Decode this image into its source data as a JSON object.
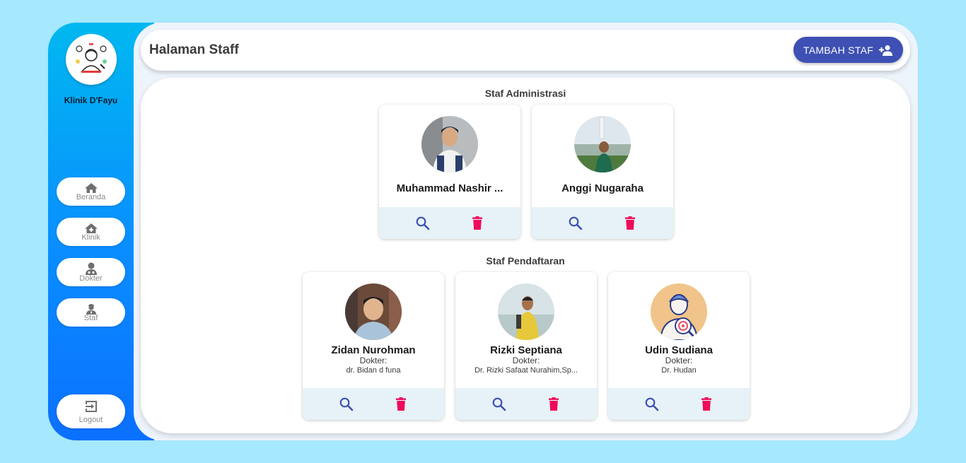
{
  "sidebar": {
    "clinic_name": "Klinik D'Fayu",
    "nav": [
      {
        "label": "Beranda",
        "icon": "home-icon"
      },
      {
        "label": "Klinik",
        "icon": "clinic-icon"
      },
      {
        "label": "Dokter",
        "icon": "doctor-icon"
      },
      {
        "label": "Staf",
        "icon": "staff-icon"
      }
    ],
    "logout_label": "Logout"
  },
  "header": {
    "title": "Halaman Staff",
    "add_button_label": "TAMBAH STAF"
  },
  "sections": [
    {
      "title": "Staf Administrasi",
      "staff": [
        {
          "name": "Muhammad Nashir ..."
        },
        {
          "name": "Anggi Nugaraha"
        }
      ]
    },
    {
      "title": "Staf Pendaftaran",
      "staff": [
        {
          "name": "Zidan Nurohman",
          "role": "Dokter:",
          "doctor": "dr. Bidan d funa"
        },
        {
          "name": "Rizki Septiana",
          "role": "Dokter:",
          "doctor": "Dr. Rizki Safaat Nurahim,Sp..."
        },
        {
          "name": "Udin Sudiana",
          "role": "Dokter:",
          "doctor": "Dr. Hudan"
        }
      ]
    }
  ],
  "colors": {
    "page_background": "#a6e8fd",
    "sidebar_top": "#00b8f0",
    "sidebar_bottom": "#0a70ff",
    "primary_button": "#3e50b4",
    "view_icon": "#3e50b4",
    "delete_icon": "#f00a5a",
    "action_bar": "#e6f2f7"
  }
}
